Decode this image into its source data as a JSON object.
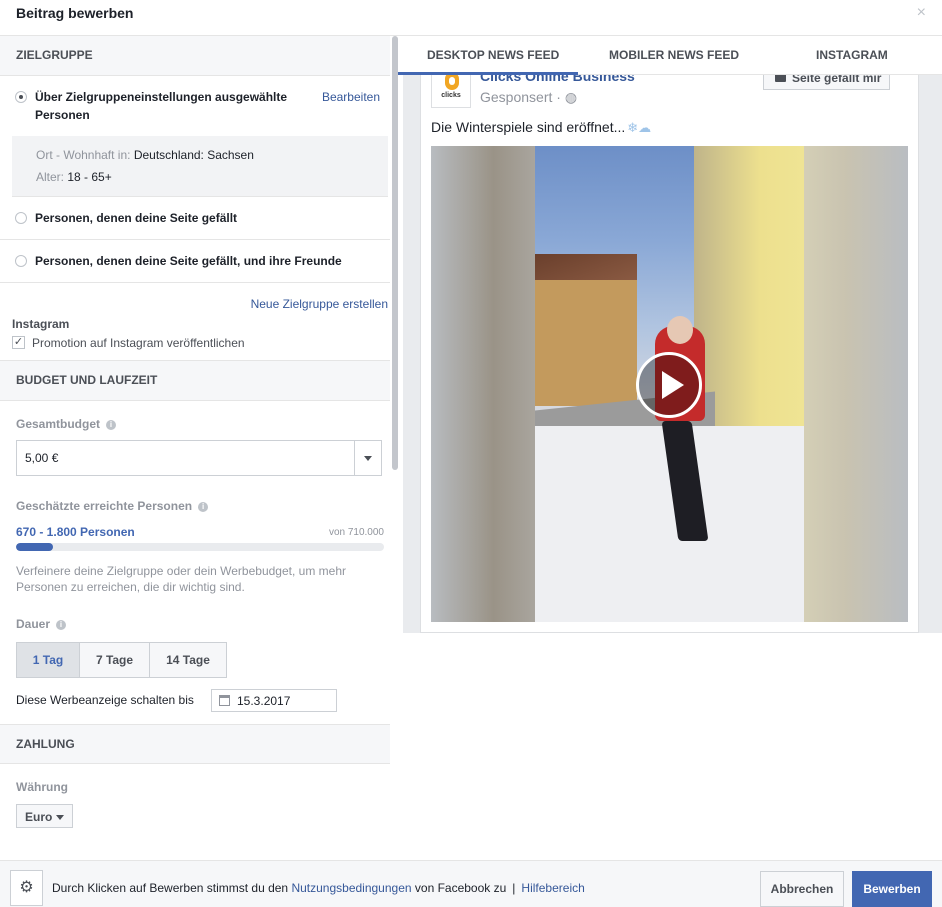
{
  "dialog": {
    "title": "Beitrag bewerben",
    "close_icon": "×"
  },
  "audience": {
    "header": "ZIELGRUPPE",
    "options": [
      {
        "label": "Über Zielgruppeneinstellungen ausgewählte Personen",
        "selected": true,
        "edit": "Bearbeiten"
      },
      {
        "label": "Personen, denen deine Seite gefällt",
        "selected": false
      },
      {
        "label": "Personen, denen deine Seite gefällt, und ihre Freunde",
        "selected": false
      }
    ],
    "details": {
      "location_key": "Ort - Wohnhaft in:",
      "location_val": "Deutschland: Sachsen",
      "age_key": "Alter:",
      "age_val": "18 - 65+"
    },
    "new_audience": "Neue Zielgruppe erstellen",
    "instagram_header": "Instagram",
    "instagram_checkbox": "Promotion auf Instagram veröffentlichen",
    "instagram_checked": true,
    "check_glyph": "✓"
  },
  "budget": {
    "header": "BUDGET UND LAUFZEIT",
    "total_label": "Gesamtbudget",
    "total_value": "5,00 €",
    "reach_label": "Geschätzte erreichte Personen",
    "reach_value": "670 - 1.800 Personen",
    "reach_of": "von 710.000",
    "reach_fraction": 0.1,
    "hint": "Verfeinere deine Zielgruppe oder dein Werbebudget, um mehr Personen zu erreichen, die dir wichtig sind.",
    "duration_label": "Dauer",
    "durations": [
      "1 Tag",
      "7 Tage",
      "14 Tage"
    ],
    "duration_selected": "1 Tag",
    "end_label": "Diese Werbeanzeige schalten bis",
    "end_date": "15.3.2017",
    "info_glyph": "i"
  },
  "payment": {
    "header": "ZAHLUNG",
    "currency_label": "Währung",
    "currency": "Euro"
  },
  "preview": {
    "tabs": [
      "DESKTOP NEWS FEED",
      "MOBILER NEWS FEED",
      "INSTAGRAM"
    ],
    "active_tab": "DESKTOP NEWS FEED",
    "page_name": "Clicks Online Business",
    "avatar_text": "clicks",
    "sponsored": "Gesponsert · ◍",
    "like_button": "Seite gefällt mir",
    "post_text": "Die Winterspiele sind eröffnet...",
    "post_emoji": "❄☁"
  },
  "footer": {
    "gear_icon": "⚙",
    "terms_prefix": "Durch Klicken auf Bewerben stimmst du den ",
    "terms_link": "Nutzungsbedingungen",
    "terms_suffix": " von Facebook zu",
    "separator": "|",
    "help_link": "Hilfebereich",
    "cancel": "Abbrechen",
    "submit": "Bewerben"
  }
}
